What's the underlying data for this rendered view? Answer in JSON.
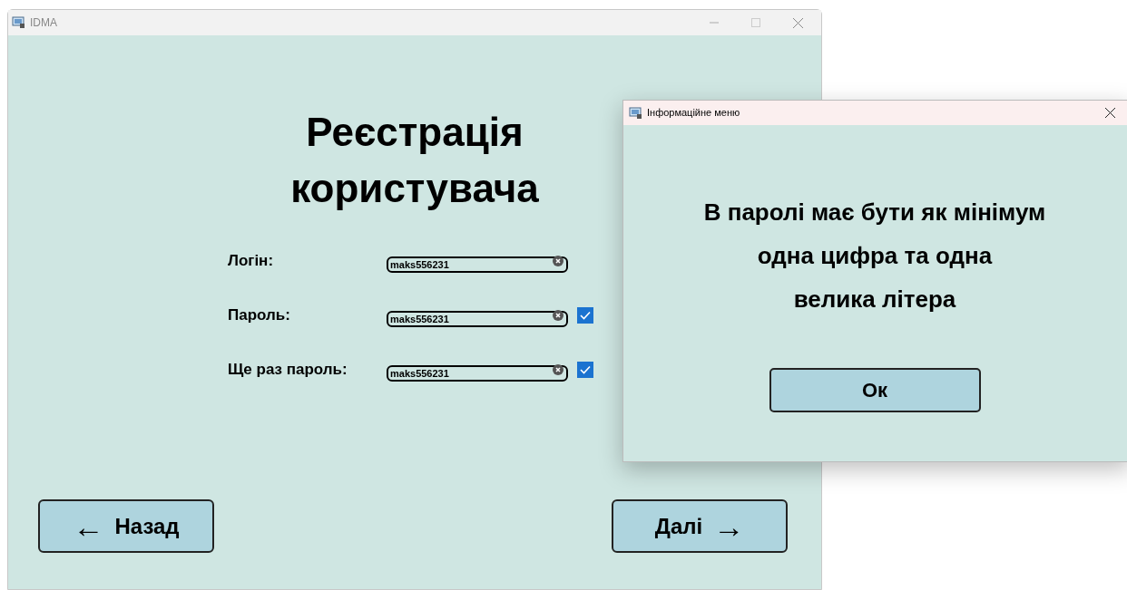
{
  "window": {
    "title": "IDMA"
  },
  "heading": [
    "Реєстрація",
    "користувача"
  ],
  "fields": [
    {
      "label": "Логін:",
      "value": "maks556231"
    },
    {
      "label": "Пароль:",
      "value": "maks556231",
      "checked": true
    },
    {
      "label": "Ще раз пароль:",
      "value": "maks556231",
      "checked": true
    }
  ],
  "back_button": {
    "arrow": "←",
    "label": "Назад"
  },
  "next_button": {
    "label": "Далі",
    "arrow": "→"
  },
  "dialog": {
    "title": "Інформаційне меню",
    "message": [
      "В паролі має бути як мінімум",
      "одна цифра та одна",
      "велика літера"
    ],
    "button": "Ок"
  }
}
